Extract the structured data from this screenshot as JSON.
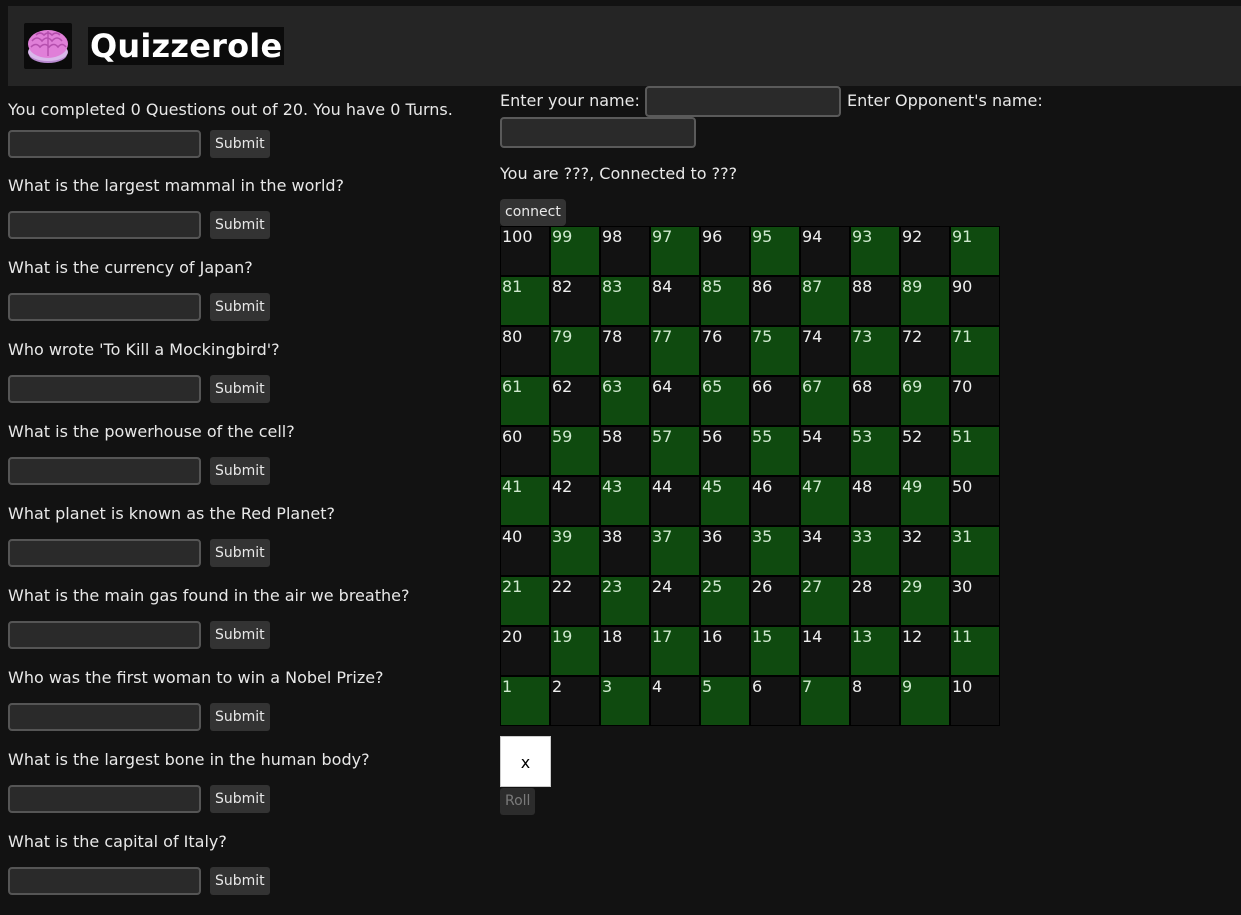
{
  "header": {
    "title": "Quizzerole",
    "logo_icon": "brain-icon"
  },
  "status_text": "You completed 0 Questions out of 20. You have 0 Turns.",
  "questions": [
    {
      "label": "",
      "answer": "",
      "submit_label": "Submit"
    },
    {
      "label": "What is the largest mammal in the world?",
      "answer": "",
      "submit_label": "Submit"
    },
    {
      "label": "What is the currency of Japan?",
      "answer": "",
      "submit_label": "Submit"
    },
    {
      "label": "Who wrote 'To Kill a Mockingbird'?",
      "answer": "",
      "submit_label": "Submit"
    },
    {
      "label": "What is the powerhouse of the cell?",
      "answer": "",
      "submit_label": "Submit"
    },
    {
      "label": "What planet is known as the Red Planet?",
      "answer": "",
      "submit_label": "Submit"
    },
    {
      "label": "What is the main gas found in the air we breathe?",
      "answer": "",
      "submit_label": "Submit"
    },
    {
      "label": "Who was the first woman to win a Nobel Prize?",
      "answer": "",
      "submit_label": "Submit"
    },
    {
      "label": "What is the largest bone in the human body?",
      "answer": "",
      "submit_label": "Submit"
    },
    {
      "label": "What is the capital of Italy?",
      "answer": "",
      "submit_label": "Submit"
    }
  ],
  "connection": {
    "name_label": "Enter your name:",
    "name_value": "",
    "opponent_label": "Enter Opponent's name:",
    "opponent_value": "",
    "status": "You are ???, Connected to ???",
    "connect_label": "connect"
  },
  "board": {
    "rows": [
      [
        100,
        99,
        98,
        97,
        96,
        95,
        94,
        93,
        92,
        91
      ],
      [
        81,
        82,
        83,
        84,
        85,
        86,
        87,
        88,
        89,
        90
      ],
      [
        80,
        79,
        78,
        77,
        76,
        75,
        74,
        73,
        72,
        71
      ],
      [
        61,
        62,
        63,
        64,
        65,
        66,
        67,
        68,
        69,
        70
      ],
      [
        60,
        59,
        58,
        57,
        56,
        55,
        54,
        53,
        52,
        51
      ],
      [
        41,
        42,
        43,
        44,
        45,
        46,
        47,
        48,
        49,
        50
      ],
      [
        40,
        39,
        38,
        37,
        36,
        35,
        34,
        33,
        32,
        31
      ],
      [
        21,
        22,
        23,
        24,
        25,
        26,
        27,
        28,
        29,
        30
      ],
      [
        20,
        19,
        18,
        17,
        16,
        15,
        14,
        13,
        12,
        11
      ],
      [
        1,
        2,
        3,
        4,
        5,
        6,
        7,
        8,
        9,
        10
      ]
    ],
    "colors": {
      "odd": "#0f4a0f",
      "even": "#121212"
    }
  },
  "dice": {
    "value": "x"
  },
  "roll_label": "Roll"
}
